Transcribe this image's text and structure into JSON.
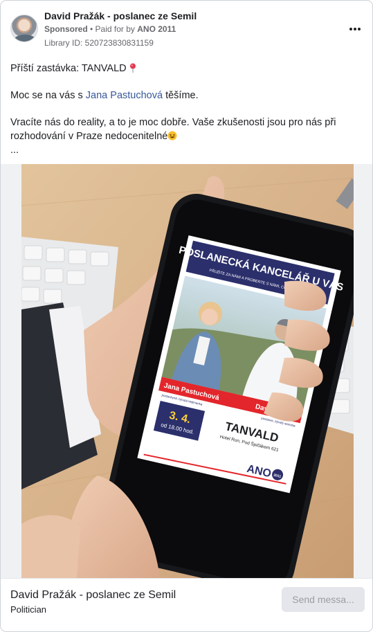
{
  "header": {
    "page_name": "David Pražák - poslanec ze Semil",
    "sponsored_label": "Sponsored",
    "separator": " • ",
    "paid_for_by_label": "Paid for by ",
    "payer": "ANO 2011",
    "library_id": "Library ID: 520723830831159"
  },
  "post": {
    "line1": "Příští zastávka: TANVALD",
    "line2_before": "Moc se na vás s ",
    "line2_tag": "Jana Pastuchová",
    "line2_after": " těšíme.",
    "line3": "Vracíte nás do reality, a to je moc dobře. Vaše zkušenosti jsou pro nás při rozhodování v Praze nedocenitelné",
    "ellipsis": "..."
  },
  "poster": {
    "title": "POSLANECKÁ KANCELÁŘ U VÁS",
    "subtitle": "PŘIJĎTE ZA NÁMI A PROBERTE S NÁMI, CO VÁS TRÁPÍ",
    "person_left": "Jana Pastuchová",
    "person_left_role": "poslankyně, bývalá hejtmanka",
    "person_right": "David Pražák",
    "person_right_role": "poslanec, bývalý starosta",
    "date": "3. 4.",
    "time": "od 18.00 hod.",
    "town": "TANVALD",
    "venue": "Hotel Ron, Pod Špičákem 621",
    "logo": "ANO",
    "logo_year": "2011"
  },
  "footer": {
    "name": "David Pražák - poslanec ze Semil",
    "category": "Politician",
    "cta_label": "Send messa..."
  },
  "icons": {
    "pin": "round-pushpin-icon",
    "emoji": "grinning-squinting-face-icon",
    "more": "more-options-icon"
  },
  "colors": {
    "link": "#385898",
    "poster_navy": "#2b2f6b",
    "poster_red": "#e3262b"
  }
}
